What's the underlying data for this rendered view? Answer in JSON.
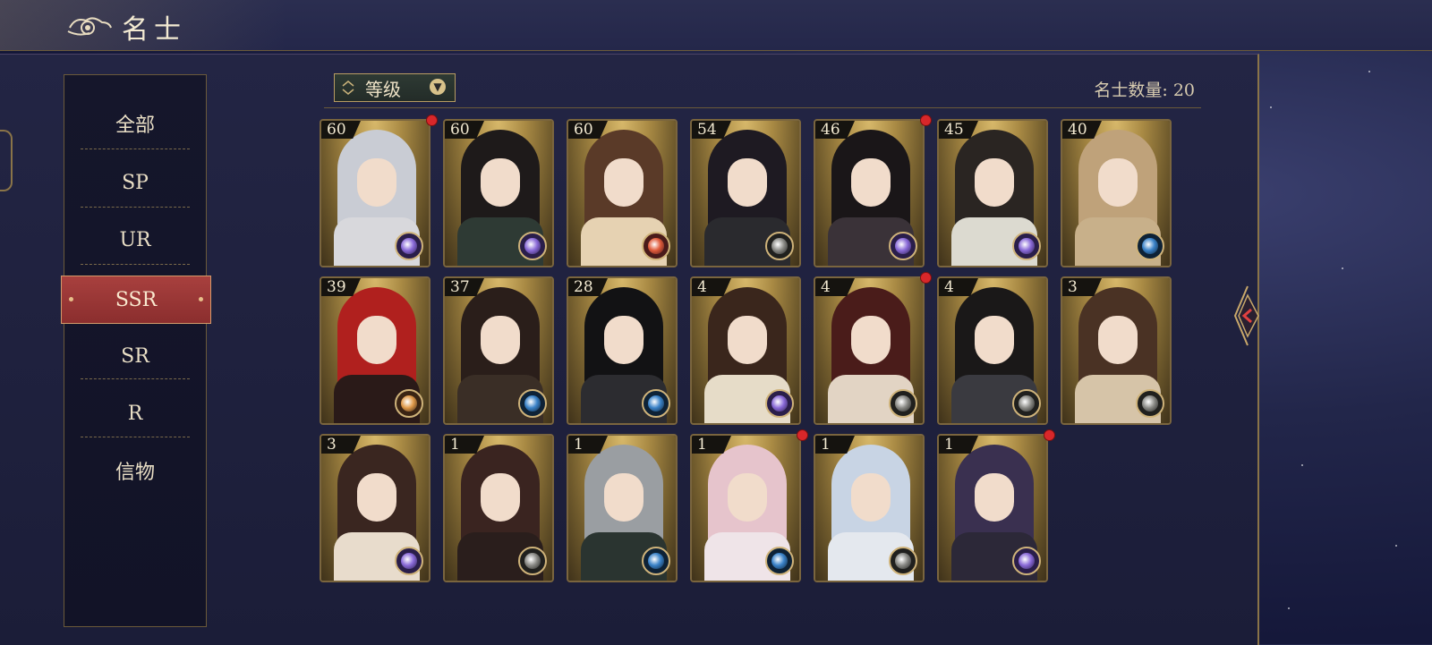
{
  "header": {
    "title": "名士"
  },
  "sidebar": {
    "items": [
      {
        "label": "全部",
        "active": false
      },
      {
        "label": "SP",
        "active": false
      },
      {
        "label": "UR",
        "active": false
      },
      {
        "label": "SSR",
        "active": true
      },
      {
        "label": "SR",
        "active": false
      },
      {
        "label": "R",
        "active": false
      },
      {
        "label": "信物",
        "active": false
      }
    ]
  },
  "toolbar": {
    "sort_label": "等级",
    "count_text": "名士数量: 20"
  },
  "colors": {
    "accent_gold": "#b89c62",
    "active_tab": "#9b3838",
    "notify_red": "#d8272a"
  },
  "cards": [
    {
      "level": "60",
      "notify": true,
      "element": "purple-orb",
      "hair": "#c9ccd4",
      "outfit": "#d8d8dc"
    },
    {
      "level": "60",
      "notify": false,
      "element": "purple-orb",
      "hair": "#1e1a1a",
      "outfit": "#2e3a34"
    },
    {
      "level": "60",
      "notify": false,
      "element": "red-orb",
      "hair": "#5a3a28",
      "outfit": "#e6d2b2"
    },
    {
      "level": "54",
      "notify": false,
      "element": "dark-orb",
      "hair": "#1e1a22",
      "outfit": "#2a2a2e"
    },
    {
      "level": "46",
      "notify": true,
      "element": "purple-orb",
      "hair": "#1a1618",
      "outfit": "#3a3238"
    },
    {
      "level": "45",
      "notify": false,
      "element": "purple-orb",
      "hair": "#2a2522",
      "outfit": "#dcdad0"
    },
    {
      "level": "40",
      "notify": false,
      "element": "blue-orb",
      "hair": "#bfa27a",
      "outfit": "#c8b08a"
    },
    {
      "level": "39",
      "notify": false,
      "element": "orange-orb",
      "hair": "#b0201e",
      "outfit": "#2a1a18"
    },
    {
      "level": "37",
      "notify": false,
      "element": "blue-orb",
      "hair": "#2a1e1a",
      "outfit": "#3a2e26"
    },
    {
      "level": "28",
      "notify": false,
      "element": "blue-orb",
      "hair": "#121214",
      "outfit": "#2c2c30"
    },
    {
      "level": "4",
      "notify": false,
      "element": "purple-orb",
      "hair": "#3a261c",
      "outfit": "#e6dcc8"
    },
    {
      "level": "4",
      "notify": true,
      "element": "dark-orb",
      "hair": "#4a1c1a",
      "outfit": "#e2d4c4"
    },
    {
      "level": "4",
      "notify": false,
      "element": "dark-orb",
      "hair": "#1a1818",
      "outfit": "#3a3a40"
    },
    {
      "level": "3",
      "notify": false,
      "element": "dark-orb",
      "hair": "#4a3224",
      "outfit": "#d6c4a8"
    },
    {
      "level": "3",
      "notify": false,
      "element": "purple-orb",
      "hair": "#3a2620",
      "outfit": "#e8dccc"
    },
    {
      "level": "1",
      "notify": false,
      "element": "dark-orb",
      "hair": "#3a2420",
      "outfit": "#2a1e1c"
    },
    {
      "level": "1",
      "notify": false,
      "element": "blue-orb",
      "hair": "#9a9ea2",
      "outfit": "#2a3430"
    },
    {
      "level": "1",
      "notify": true,
      "element": "blue-orb",
      "hair": "#e6c4cc",
      "outfit": "#efe4e8"
    },
    {
      "level": "1",
      "notify": false,
      "element": "dark-orb",
      "hair": "#c8d4e4",
      "outfit": "#e4e8ee"
    },
    {
      "level": "1",
      "notify": true,
      "element": "purple-orb",
      "hair": "#3a3050",
      "outfit": "#2c2838"
    }
  ]
}
